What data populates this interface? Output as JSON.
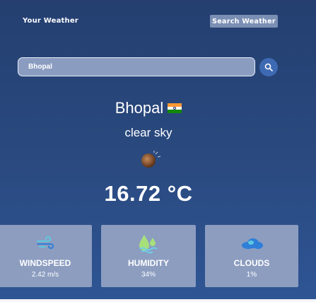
{
  "header": {
    "brand": "Your Weather",
    "search_weather_label": "Search Weather"
  },
  "search": {
    "value": "Bhopal"
  },
  "current": {
    "city": "Bhopal",
    "country_flag": "IN",
    "description": "clear sky",
    "temperature": "16.72 °C"
  },
  "stats": {
    "windspeed": {
      "title": "WINDSPEED",
      "value": "2.42 m/s"
    },
    "humidity": {
      "title": "HUMIDITY",
      "value": "34%"
    },
    "clouds": {
      "title": "CLOUDS",
      "value": "1%"
    }
  },
  "colors": {
    "accent": "#3d6ab2",
    "card_bg": "#8c9dc0",
    "icon_teal": "#5ec8e0",
    "icon_blue": "#2f7fd8"
  }
}
